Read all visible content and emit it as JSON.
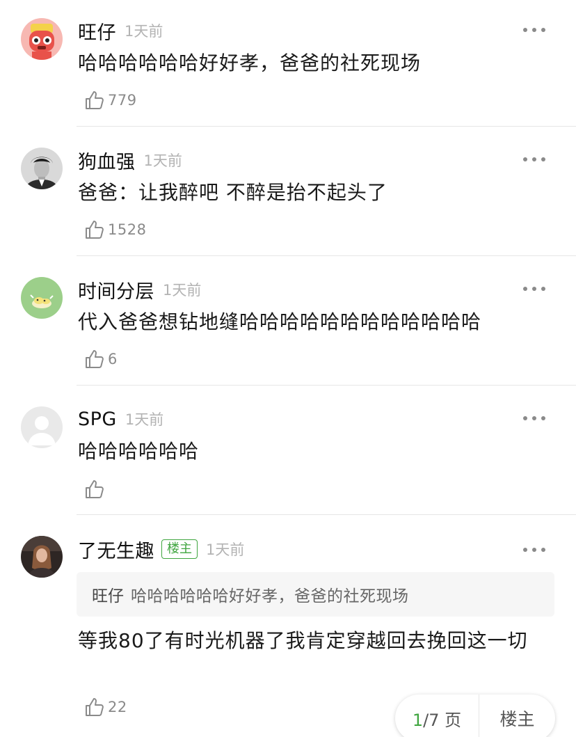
{
  "comments": [
    {
      "name": "旺仔",
      "time": "1天前",
      "content": "哈哈哈哈哈哈好好孝，爸爸的社死现场",
      "likes": "779",
      "avatar_icon": "cartoon-character-avatar-icon"
    },
    {
      "name": "狗血强",
      "time": "1天前",
      "content": "爸爸：让我醉吧 不醉是抬不起头了",
      "likes": "1528",
      "avatar_icon": "man-portrait-avatar-icon"
    },
    {
      "name": "时间分层",
      "time": "1天前",
      "content": "代入爸爸想钻地缝哈哈哈哈哈哈哈哈哈哈哈哈",
      "likes": "6",
      "avatar_icon": "green-illustration-avatar-icon"
    },
    {
      "name": "SPG",
      "time": "1天前",
      "content": "哈哈哈哈哈哈",
      "likes": "",
      "avatar_icon": "default-user-avatar-icon"
    },
    {
      "name": "了无生趣",
      "badge": "楼主",
      "time": "1天前",
      "quote_author": "旺仔",
      "quote_text": "哈哈哈哈哈哈好好孝，爸爸的社死现场",
      "content": "等我80了有时光机器了我肯定穿越回去挽回这一切",
      "likes": "22",
      "avatar_icon": "woman-photo-avatar-icon"
    }
  ],
  "pager": {
    "current": "1",
    "total": "/7 页",
    "op_label": "楼主"
  },
  "colors": {
    "accent_green": "#3fa53f",
    "muted_text": "#8a8a8a",
    "divider": "#e6e6e6"
  }
}
